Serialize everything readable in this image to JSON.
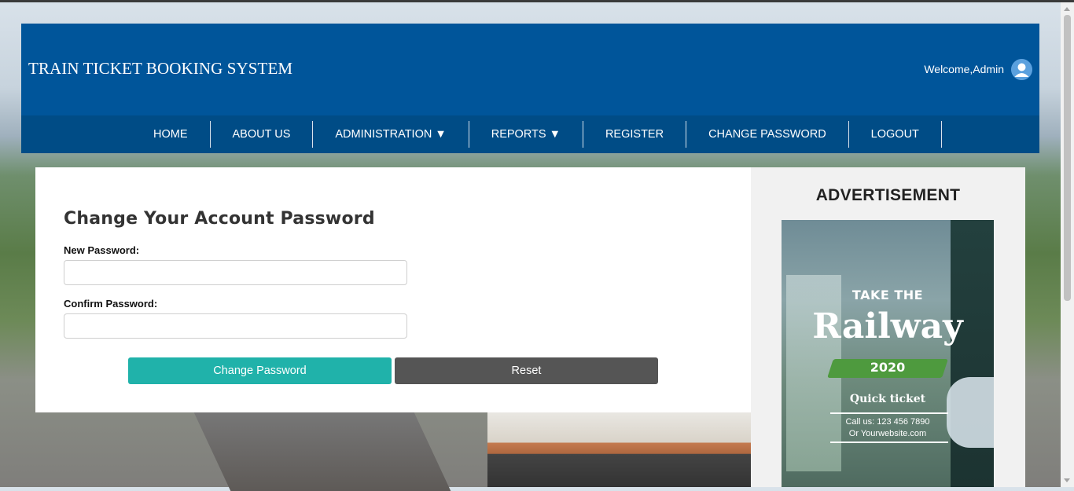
{
  "header": {
    "brand": "TRAIN TICKET BOOKING SYSTEM",
    "welcome": "Welcome,Admin",
    "avatar_icon": "user-avatar-icon"
  },
  "nav": {
    "items": [
      {
        "label": "HOME"
      },
      {
        "label": "ABOUT US"
      },
      {
        "label": "ADMINISTRATION ▼"
      },
      {
        "label": "REPORTS ▼"
      },
      {
        "label": "REGISTER"
      },
      {
        "label": "CHANGE PASSWORD"
      },
      {
        "label": "LOGOUT"
      }
    ]
  },
  "form": {
    "title": "Change Your Account Password",
    "new_password_label": "New Password:",
    "new_password_value": "",
    "confirm_password_label": "Confirm Password:",
    "confirm_password_value": "",
    "submit_label": "Change Password",
    "reset_label": "Reset"
  },
  "sidebar": {
    "title": "ADVERTISEMENT",
    "ad": {
      "line1": "TAKE THE",
      "line2": "Railway",
      "line3": "2020",
      "line4": "Quick ticket",
      "line5": "Call us: 123 456 7890",
      "line6": "Or Yourwebsite.com"
    }
  },
  "colors": {
    "header_bg": "#00559a",
    "nav_bg": "#004c86",
    "primary_button": "#20b2aa",
    "reset_button": "#555555"
  }
}
